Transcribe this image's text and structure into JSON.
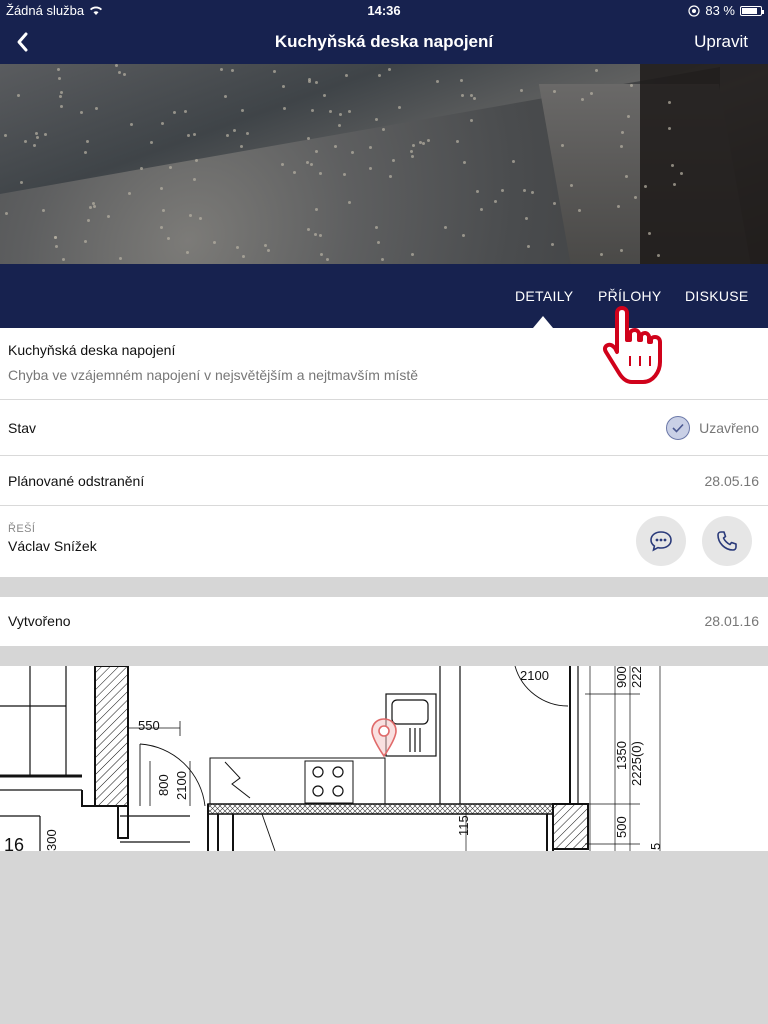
{
  "status_bar": {
    "carrier": "Žádná služba",
    "time": "14:36",
    "battery": "83 %",
    "battery_level": 0.83
  },
  "nav": {
    "title": "Kuchyňská deska napojení",
    "edit_label": "Upravit",
    "back_icon": "chevron-left-icon"
  },
  "tabs": {
    "detaily": "DETAILY",
    "prilohy": "PŘÍLOHY",
    "diskuse": "DISKUSE"
  },
  "detail": {
    "title": "Kuchyňská deska napojení",
    "description": "Chyba ve vzájemném napojení v nejsvětějším a nejtmavším místě",
    "status_label": "Stav",
    "status_value": "Uzavřeno",
    "planned_label": "Plánované odstranění",
    "planned_value": "28.05.16",
    "assignee_label": "ŘEŠÍ",
    "assignee_name": "Václav Snížek",
    "created_label": "Vytvořeno",
    "created_value": "28.01.16"
  },
  "plan_labels": {
    "d2100_top": "2100",
    "d550": "550",
    "d800": "800",
    "d2100_door": "2100",
    "d1350": "1350",
    "d2225": "2225(0)",
    "d900": "900",
    "d222": "222",
    "d500": "500",
    "d115": "115",
    "d300": "300",
    "d16": "16",
    "d5": "5"
  },
  "colors": {
    "navy": "#17224f",
    "accent_red": "#d0021b"
  }
}
